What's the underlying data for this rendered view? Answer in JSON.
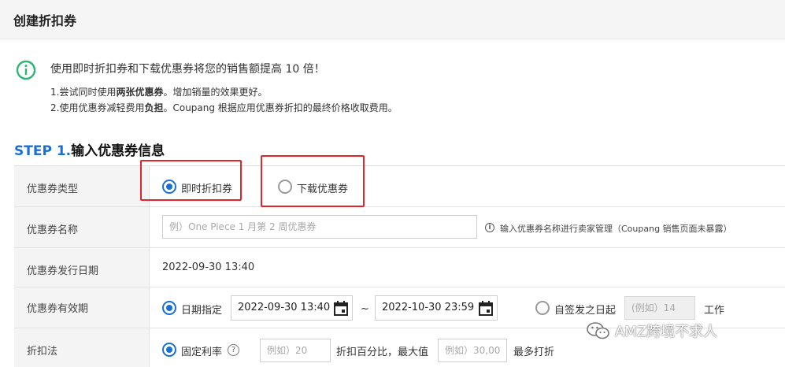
{
  "header": {
    "title": "创建折扣券"
  },
  "notice": {
    "main": "使用即时折扣券和下载优惠券将您的销售额提高 10 倍！",
    "line1_prefix": "1.尝试同时使用",
    "line1_bold": "两张优惠券",
    "line1_suffix": "。增加销量的效果更好。",
    "line2_prefix": "2.使用优惠券减轻费用",
    "line2_bold": "负担",
    "line2_suffix": "。Coupang 根据应用优惠券折扣的最终价格收取费用。"
  },
  "step": {
    "number": "STEP 1.",
    "title": "输入优惠券信息"
  },
  "form": {
    "coupon_type": {
      "label": "优惠券类型",
      "option_instant": "即时折扣券",
      "option_download": "下载优惠券"
    },
    "coupon_name": {
      "label": "优惠券名称",
      "placeholder": "例）One Piece 1 月第 2 周优惠券",
      "hint": "输入优惠券名称进行卖家管理（Coupang 销售页面未暴露）"
    },
    "issue_date": {
      "label": "优惠券发行日期",
      "value": "2022-09-30 13:40"
    },
    "validity": {
      "label": "优惠券有效期",
      "option_date": "日期指定",
      "start": "2022-09-30 13:40",
      "separator": "~",
      "end": "2022-10-30 23:59",
      "option_days": "自签发之日起",
      "days_placeholder": "(例如）14",
      "days_unit": "工作"
    },
    "discount": {
      "label": "折扣法",
      "option_fixed": "固定利率",
      "rate_placeholder": "例如）20",
      "percent_text": "折扣百分比，最大值",
      "max_placeholder": "例如）30,000",
      "max_suffix": "最多打折"
    }
  },
  "watermark": {
    "text": "AMZ跨境不求人"
  },
  "colors": {
    "accent": "#1a6fd6",
    "success": "#2bb673",
    "highlight": "#e0262a"
  }
}
